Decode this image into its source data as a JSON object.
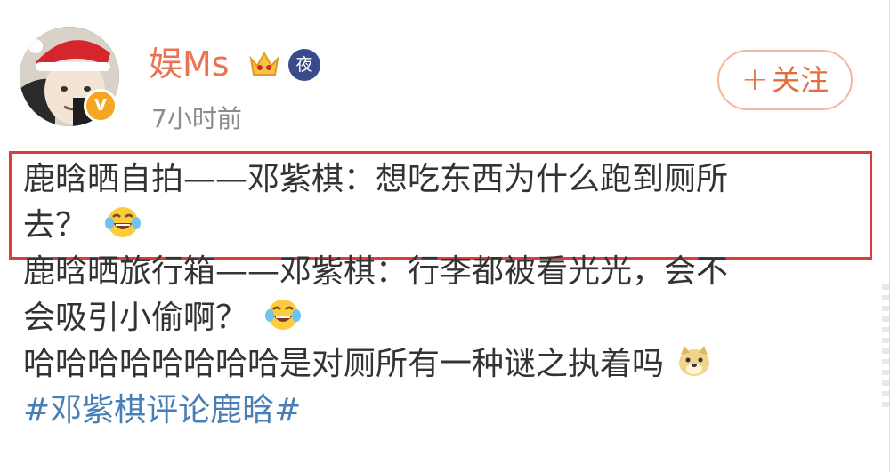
{
  "post": {
    "username": "娱Ms",
    "timestamp": "7小时前",
    "badges": {
      "vip_badge": "crown-badge-icon",
      "night_badge": "夜",
      "verified_badge": "V"
    },
    "follow_button": {
      "plus": "+",
      "label": "关注"
    },
    "lines": [
      "鹿晗晒自拍——邓紫棋：想吃东西为什么跑到厕所",
      "去？",
      "鹿晗晒旅行箱——邓紫棋：行李都被看光光，会不",
      "会吸引小偷啊？",
      "哈哈哈哈哈哈哈哈是对厕所有一种谜之执着吗"
    ],
    "hashtag": "#邓紫棋评论鹿晗#",
    "colors": {
      "username": "#eb7350",
      "highlight": "#e03a3a",
      "hashtag": "#4a7fb5",
      "follow": "#e86b3a"
    },
    "icons": [
      "laughing-tears-emoji-icon",
      "laughing-tears-emoji-icon",
      "doge-emoji-icon"
    ]
  }
}
